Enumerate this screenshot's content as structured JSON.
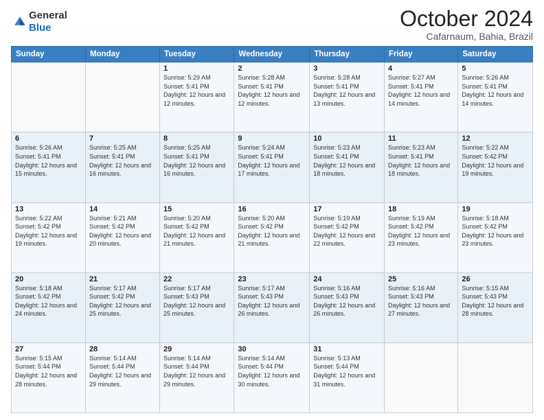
{
  "logo": {
    "general": "General",
    "blue": "Blue"
  },
  "header": {
    "month": "October 2024",
    "location": "Cafarnaum, Bahia, Brazil"
  },
  "weekdays": [
    "Sunday",
    "Monday",
    "Tuesday",
    "Wednesday",
    "Thursday",
    "Friday",
    "Saturday"
  ],
  "weeks": [
    [
      {
        "day": "",
        "sunrise": "",
        "sunset": "",
        "daylight": ""
      },
      {
        "day": "",
        "sunrise": "",
        "sunset": "",
        "daylight": ""
      },
      {
        "day": "1",
        "sunrise": "Sunrise: 5:29 AM",
        "sunset": "Sunset: 5:41 PM",
        "daylight": "Daylight: 12 hours and 12 minutes."
      },
      {
        "day": "2",
        "sunrise": "Sunrise: 5:28 AM",
        "sunset": "Sunset: 5:41 PM",
        "daylight": "Daylight: 12 hours and 12 minutes."
      },
      {
        "day": "3",
        "sunrise": "Sunrise: 5:28 AM",
        "sunset": "Sunset: 5:41 PM",
        "daylight": "Daylight: 12 hours and 13 minutes."
      },
      {
        "day": "4",
        "sunrise": "Sunrise: 5:27 AM",
        "sunset": "Sunset: 5:41 PM",
        "daylight": "Daylight: 12 hours and 14 minutes."
      },
      {
        "day": "5",
        "sunrise": "Sunrise: 5:26 AM",
        "sunset": "Sunset: 5:41 PM",
        "daylight": "Daylight: 12 hours and 14 minutes."
      }
    ],
    [
      {
        "day": "6",
        "sunrise": "Sunrise: 5:26 AM",
        "sunset": "Sunset: 5:41 PM",
        "daylight": "Daylight: 12 hours and 15 minutes."
      },
      {
        "day": "7",
        "sunrise": "Sunrise: 5:25 AM",
        "sunset": "Sunset: 5:41 PM",
        "daylight": "Daylight: 12 hours and 16 minutes."
      },
      {
        "day": "8",
        "sunrise": "Sunrise: 5:25 AM",
        "sunset": "Sunset: 5:41 PM",
        "daylight": "Daylight: 12 hours and 16 minutes."
      },
      {
        "day": "9",
        "sunrise": "Sunrise: 5:24 AM",
        "sunset": "Sunset: 5:41 PM",
        "daylight": "Daylight: 12 hours and 17 minutes."
      },
      {
        "day": "10",
        "sunrise": "Sunrise: 5:23 AM",
        "sunset": "Sunset: 5:41 PM",
        "daylight": "Daylight: 12 hours and 18 minutes."
      },
      {
        "day": "11",
        "sunrise": "Sunrise: 5:23 AM",
        "sunset": "Sunset: 5:41 PM",
        "daylight": "Daylight: 12 hours and 18 minutes."
      },
      {
        "day": "12",
        "sunrise": "Sunrise: 5:22 AM",
        "sunset": "Sunset: 5:42 PM",
        "daylight": "Daylight: 12 hours and 19 minutes."
      }
    ],
    [
      {
        "day": "13",
        "sunrise": "Sunrise: 5:22 AM",
        "sunset": "Sunset: 5:42 PM",
        "daylight": "Daylight: 12 hours and 19 minutes."
      },
      {
        "day": "14",
        "sunrise": "Sunrise: 5:21 AM",
        "sunset": "Sunset: 5:42 PM",
        "daylight": "Daylight: 12 hours and 20 minutes."
      },
      {
        "day": "15",
        "sunrise": "Sunrise: 5:20 AM",
        "sunset": "Sunset: 5:42 PM",
        "daylight": "Daylight: 12 hours and 21 minutes."
      },
      {
        "day": "16",
        "sunrise": "Sunrise: 5:20 AM",
        "sunset": "Sunset: 5:42 PM",
        "daylight": "Daylight: 12 hours and 21 minutes."
      },
      {
        "day": "17",
        "sunrise": "Sunrise: 5:19 AM",
        "sunset": "Sunset: 5:42 PM",
        "daylight": "Daylight: 12 hours and 22 minutes."
      },
      {
        "day": "18",
        "sunrise": "Sunrise: 5:19 AM",
        "sunset": "Sunset: 5:42 PM",
        "daylight": "Daylight: 12 hours and 23 minutes."
      },
      {
        "day": "19",
        "sunrise": "Sunrise: 5:18 AM",
        "sunset": "Sunset: 5:42 PM",
        "daylight": "Daylight: 12 hours and 23 minutes."
      }
    ],
    [
      {
        "day": "20",
        "sunrise": "Sunrise: 5:18 AM",
        "sunset": "Sunset: 5:42 PM",
        "daylight": "Daylight: 12 hours and 24 minutes."
      },
      {
        "day": "21",
        "sunrise": "Sunrise: 5:17 AM",
        "sunset": "Sunset: 5:42 PM",
        "daylight": "Daylight: 12 hours and 25 minutes."
      },
      {
        "day": "22",
        "sunrise": "Sunrise: 5:17 AM",
        "sunset": "Sunset: 5:43 PM",
        "daylight": "Daylight: 12 hours and 25 minutes."
      },
      {
        "day": "23",
        "sunrise": "Sunrise: 5:17 AM",
        "sunset": "Sunset: 5:43 PM",
        "daylight": "Daylight: 12 hours and 26 minutes."
      },
      {
        "day": "24",
        "sunrise": "Sunrise: 5:16 AM",
        "sunset": "Sunset: 5:43 PM",
        "daylight": "Daylight: 12 hours and 26 minutes."
      },
      {
        "day": "25",
        "sunrise": "Sunrise: 5:16 AM",
        "sunset": "Sunset: 5:43 PM",
        "daylight": "Daylight: 12 hours and 27 minutes."
      },
      {
        "day": "26",
        "sunrise": "Sunrise: 5:15 AM",
        "sunset": "Sunset: 5:43 PM",
        "daylight": "Daylight: 12 hours and 28 minutes."
      }
    ],
    [
      {
        "day": "27",
        "sunrise": "Sunrise: 5:15 AM",
        "sunset": "Sunset: 5:44 PM",
        "daylight": "Daylight: 12 hours and 28 minutes."
      },
      {
        "day": "28",
        "sunrise": "Sunrise: 5:14 AM",
        "sunset": "Sunset: 5:44 PM",
        "daylight": "Daylight: 12 hours and 29 minutes."
      },
      {
        "day": "29",
        "sunrise": "Sunrise: 5:14 AM",
        "sunset": "Sunset: 5:44 PM",
        "daylight": "Daylight: 12 hours and 29 minutes."
      },
      {
        "day": "30",
        "sunrise": "Sunrise: 5:14 AM",
        "sunset": "Sunset: 5:44 PM",
        "daylight": "Daylight: 12 hours and 30 minutes."
      },
      {
        "day": "31",
        "sunrise": "Sunrise: 5:13 AM",
        "sunset": "Sunset: 5:44 PM",
        "daylight": "Daylight: 12 hours and 31 minutes."
      },
      {
        "day": "",
        "sunrise": "",
        "sunset": "",
        "daylight": ""
      },
      {
        "day": "",
        "sunrise": "",
        "sunset": "",
        "daylight": ""
      }
    ]
  ]
}
